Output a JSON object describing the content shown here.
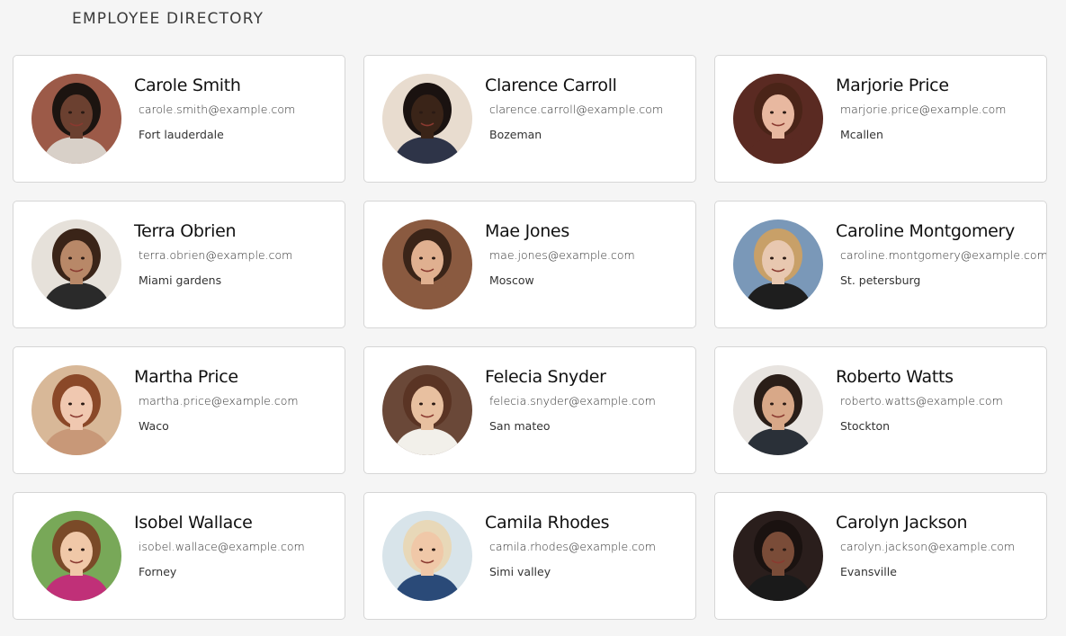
{
  "header": {
    "title": "EMPLOYEE DIRECTORY"
  },
  "employees": [
    {
      "name": "Carole Smith",
      "email": "carole.smith@example.com",
      "city": "Fort lauderdale",
      "colors": {
        "bg": "#9c5a48",
        "skin": "#6b4030",
        "hair": "#1c1410",
        "shirt": "#d8d0c8"
      }
    },
    {
      "name": "Clarence Carroll",
      "email": "clarence.carroll@example.com",
      "city": "Bozeman",
      "colors": {
        "bg": "#e8dccf",
        "skin": "#3a2418",
        "hair": "#1a1210",
        "shirt": "#2e3448"
      }
    },
    {
      "name": "Marjorie Price",
      "email": "marjorie.price@example.com",
      "city": "Mcallen",
      "colors": {
        "bg": "#5a2a22",
        "skin": "#e8b8a0",
        "hair": "#4a2418",
        "shirt": "#5a2a22"
      }
    },
    {
      "name": "Terra Obrien",
      "email": "terra.obrien@example.com",
      "city": "Miami gardens",
      "colors": {
        "bg": "#e6e1da",
        "skin": "#b88868",
        "hair": "#3a2418",
        "shirt": "#2a2a2a"
      }
    },
    {
      "name": "Mae Jones",
      "email": "mae.jones@example.com",
      "city": "Moscow",
      "colors": {
        "bg": "#8a5a40",
        "skin": "#e0b090",
        "hair": "#3a2418",
        "shirt": "#8a5a40"
      }
    },
    {
      "name": "Caroline Montgomery",
      "email": "caroline.montgomery@example.com",
      "city": "St. petersburg",
      "colors": {
        "bg": "#7a98b8",
        "skin": "#e8c8b0",
        "hair": "#c8a068",
        "shirt": "#1e1e1e"
      }
    },
    {
      "name": "Martha Price",
      "email": "martha.price@example.com",
      "city": "Waco",
      "colors": {
        "bg": "#d8b898",
        "skin": "#f0c8b0",
        "hair": "#8a4828",
        "shirt": "#c89878"
      }
    },
    {
      "name": "Felecia Snyder",
      "email": "felecia.snyder@example.com",
      "city": "San mateo",
      "colors": {
        "bg": "#6a4838",
        "skin": "#e8c0a0",
        "hair": "#5a3424",
        "shirt": "#f2f0ea"
      }
    },
    {
      "name": "Roberto Watts",
      "email": "roberto.watts@example.com",
      "city": "Stockton",
      "colors": {
        "bg": "#e8e4e0",
        "skin": "#d8a888",
        "hair": "#2a1e18",
        "shirt": "#2a3038"
      }
    },
    {
      "name": "Isobel Wallace",
      "email": "isobel.wallace@example.com",
      "city": "Forney",
      "colors": {
        "bg": "#78a858",
        "skin": "#f0c8a8",
        "hair": "#7a4a28",
        "shirt": "#c03078"
      }
    },
    {
      "name": "Camila Rhodes",
      "email": "camila.rhodes@example.com",
      "city": "Simi valley",
      "colors": {
        "bg": "#d8e4ea",
        "skin": "#f0c8a8",
        "hair": "#e8d8b8",
        "shirt": "#2a4a78"
      }
    },
    {
      "name": "Carolyn Jackson",
      "email": "carolyn.jackson@example.com",
      "city": "Evansville",
      "colors": {
        "bg": "#2a1e1c",
        "skin": "#7a4c38",
        "hair": "#1a1210",
        "shirt": "#1a1a1a"
      }
    }
  ]
}
